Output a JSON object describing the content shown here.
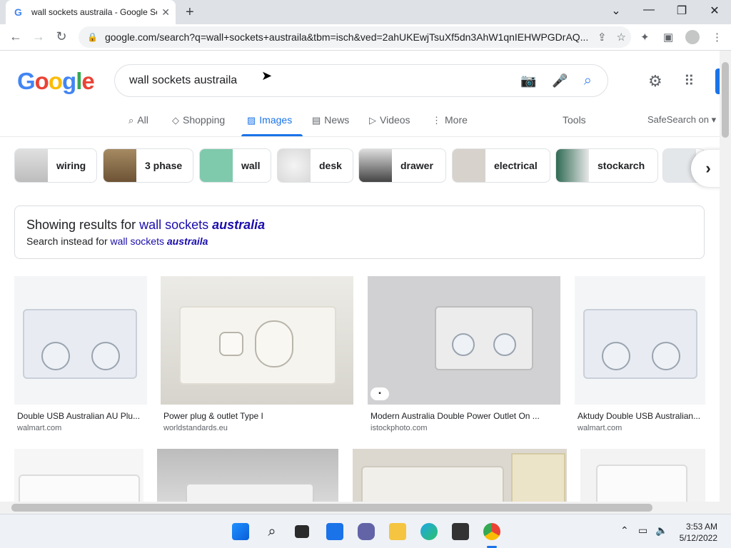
{
  "browser": {
    "tab_title": "wall sockets austraila - Google Se",
    "favicon": "G",
    "url": "google.com/search?q=wall+sockets+austraila&tbm=isch&ved=2ahUKEwjTsuXf5dn3AhW1qnIEHWPGDrAQ..."
  },
  "search": {
    "query": "wall sockets austraila"
  },
  "tabs": [
    {
      "label": "All",
      "icon": "search-icon"
    },
    {
      "label": "Shopping",
      "icon": "tag-icon"
    },
    {
      "label": "Images",
      "icon": "image-icon"
    },
    {
      "label": "News",
      "icon": "news-icon"
    },
    {
      "label": "Videos",
      "icon": "play-icon"
    },
    {
      "label": "More",
      "icon": "more-vert-icon"
    }
  ],
  "tools_label": "Tools",
  "safesearch_label": "SafeSearch on",
  "chips": [
    "wiring",
    "3 phase",
    "wall",
    "desk",
    "drawer",
    "electrical",
    "stockarch"
  ],
  "spelling": {
    "showing_prefix": "Showing results for",
    "showing_query": "wall sockets",
    "showing_corrected": "australia",
    "instead_prefix": "Search instead for",
    "instead_query": "wall sockets",
    "instead_original": "austraila"
  },
  "results": [
    {
      "title": "Double USB Australian AU Plu...",
      "source": "walmart.com"
    },
    {
      "title": "Power plug & outlet Type I",
      "source": "worldstandards.eu"
    },
    {
      "title": "Modern Australia Double Power Outlet On ...",
      "source": "istockphoto.com"
    },
    {
      "title": "Aktudy Double USB Australian...",
      "source": "walmart.com"
    }
  ],
  "taskbar": {
    "time": "3:53 AM",
    "date": "5/12/2022"
  },
  "colors": {
    "google_blue": "#4285F4",
    "google_red": "#EA4335",
    "google_yellow": "#FBBC05",
    "google_green": "#34A853",
    "link": "#1a0dab",
    "accent": "#1a73e8"
  }
}
